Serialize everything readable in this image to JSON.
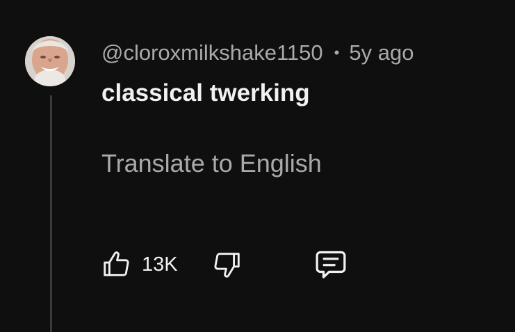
{
  "comment": {
    "author": "@cloroxmilkshake1150",
    "separator": "•",
    "timestamp": "5y ago",
    "text": "classical twerking",
    "translate_label": "Translate to English",
    "like_count": "13K",
    "icons": {
      "like": "thumbs-up-icon",
      "dislike": "thumbs-down-icon",
      "reply": "comment-reply-icon"
    },
    "colors": {
      "background": "#0f0f0f",
      "primary_text": "#f1f1f1",
      "secondary_text": "#aaaaaa"
    }
  }
}
